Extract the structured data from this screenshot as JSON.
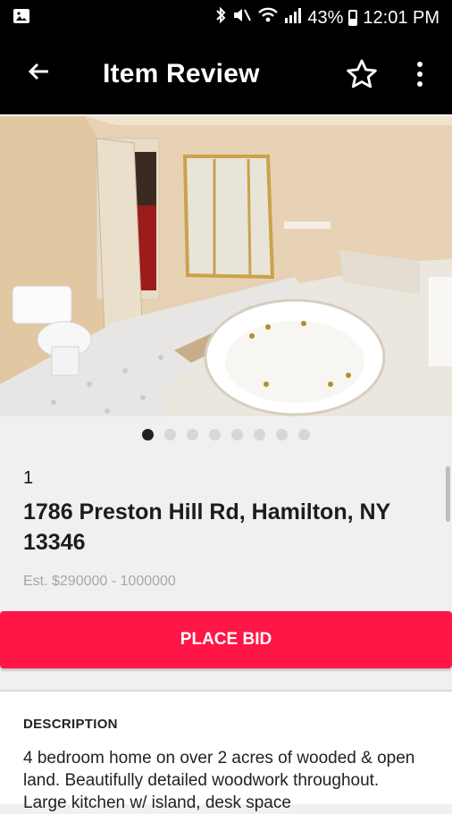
{
  "status_bar": {
    "battery": "43%",
    "time": "12:01 PM",
    "icons": [
      "image-icon",
      "bluetooth-icon",
      "mute-icon",
      "wifi-icon",
      "signal-icon",
      "battery-icon"
    ]
  },
  "app_bar": {
    "title": "Item Review",
    "icons": [
      "back-arrow-icon",
      "star-outline-icon",
      "more-vert-icon"
    ]
  },
  "gallery": {
    "dot_count": 8,
    "active_index": 0
  },
  "listing": {
    "lot_number": "1",
    "address": "1786 Preston Hill Rd, Hamilton, NY 13346",
    "estimate": "Est. $290000 - 1000000",
    "bid_button_label": "PLACE BID",
    "accent_color": "#ff1646"
  },
  "description": {
    "heading": "DESCRIPTION",
    "text": "4 bedroom home on over 2 acres of wooded & open land. Beautifully detailed woodwork throughout. Large kitchen w/ island, desk space"
  }
}
